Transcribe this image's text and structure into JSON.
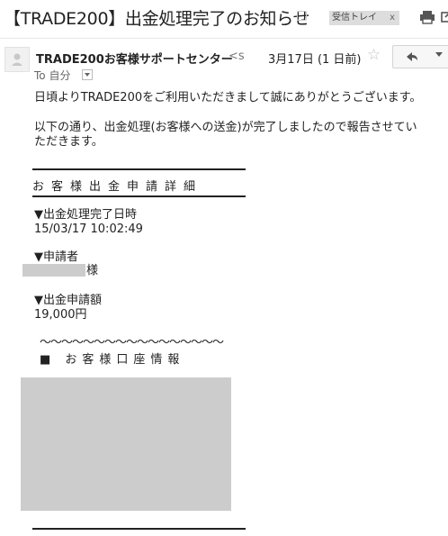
{
  "email": {
    "subject": "【TRADE200】出金処理完了のお知らせ",
    "label": "受信トレイ",
    "label_close": "x",
    "sender_name": "TRADE200お客様サポートセンター",
    "sender_email_fragment": "<s",
    "date": "3月17日 (1 日前)",
    "to": "To 自分"
  },
  "body": {
    "greeting": "日頃よりTRADE200をご利用いただきまして誠にありがとうございます。",
    "intro_line1": "以下の通り、出金処理(お客様への送金)が完了しましたので報告させてい",
    "intro_line2": "ただきます。",
    "section_title": "お客様出金申請詳細",
    "completed_label": "▼出金処理完了日時",
    "completed_value": "15/03/17 10:02:49",
    "applicant_label": "▼申請者",
    "applicant_suffix": "様",
    "amount_label": "▼出金申請額",
    "amount_value": "19,000円",
    "wave_line": "〜〜〜〜〜〜〜〜〜〜〜〜〜〜〜〜〜",
    "account_title": "■ お客様口座情報"
  }
}
